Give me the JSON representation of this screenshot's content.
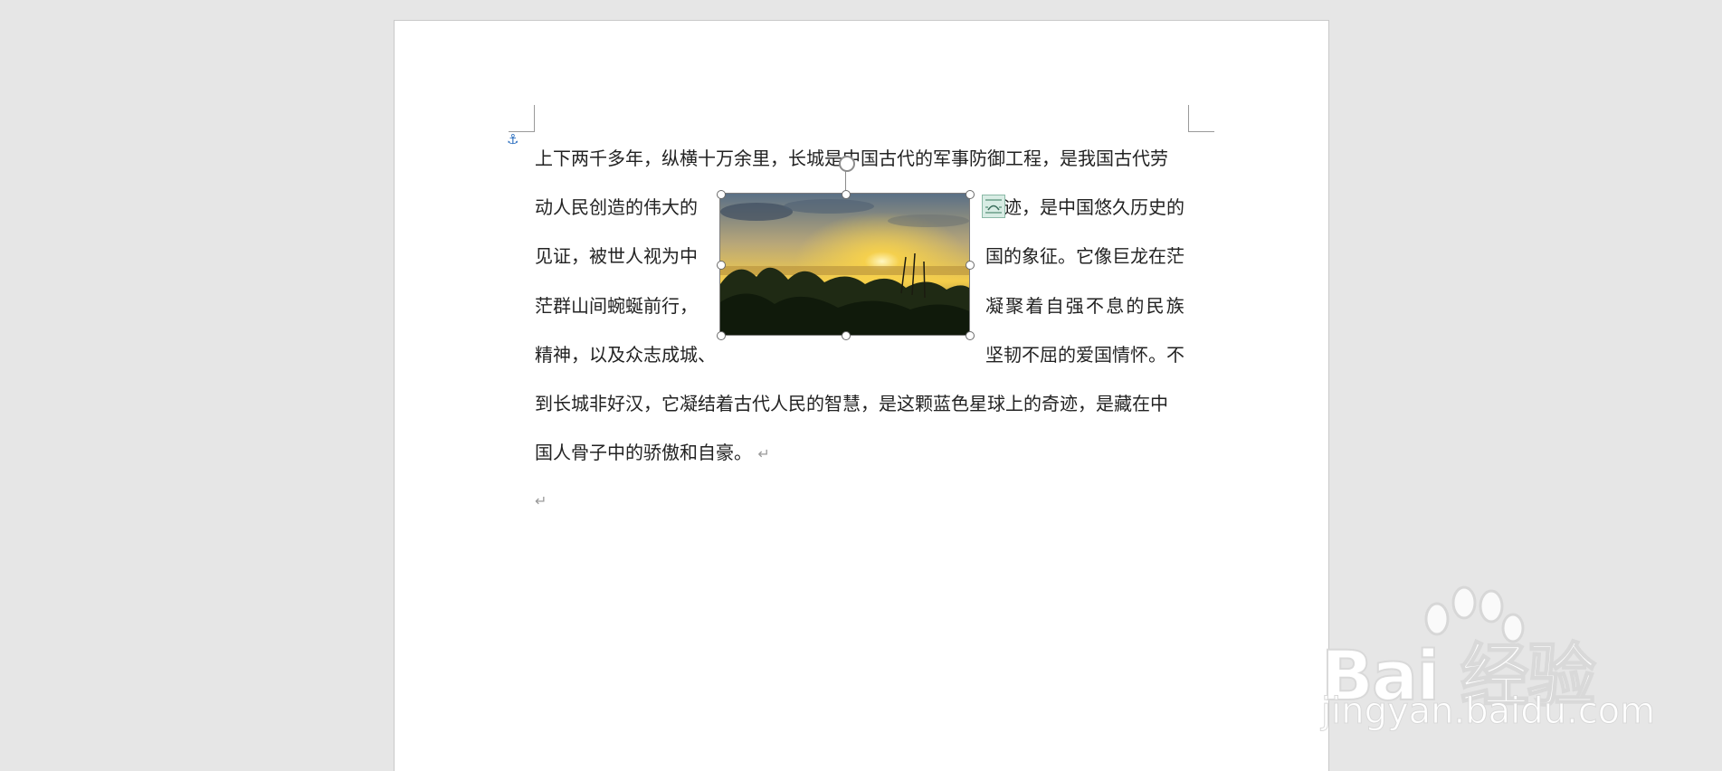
{
  "document": {
    "lines": [
      "上下两千多年，纵横十万余里，长城是中国古代的军事防御工程，是我国古代劳",
      "动人民创造的伟大的",
      "迹，是中国悠久历史的",
      "见证，被世人视为中",
      "国的象征。它像巨龙在茫",
      "茫群山间蜿蜒前行，",
      "凝聚着自强不息的民族",
      "精神，以及众志成城、",
      "坚韧不屈的爱国情怀。不",
      "到长城非好汉，它凝结着古代人民的智慧，是这颗蓝色星球上的奇迹，是藏在中",
      "国人骨子中的骄傲和自豪。"
    ],
    "paragraph_mark": "↵"
  },
  "watermark": {
    "brand": "Bai 经验",
    "url": "jingyan.baidu.com"
  },
  "colors": {
    "page_bg": "#ffffff",
    "app_bg": "#e6e6e6",
    "anchor": "#2c6fbf"
  }
}
